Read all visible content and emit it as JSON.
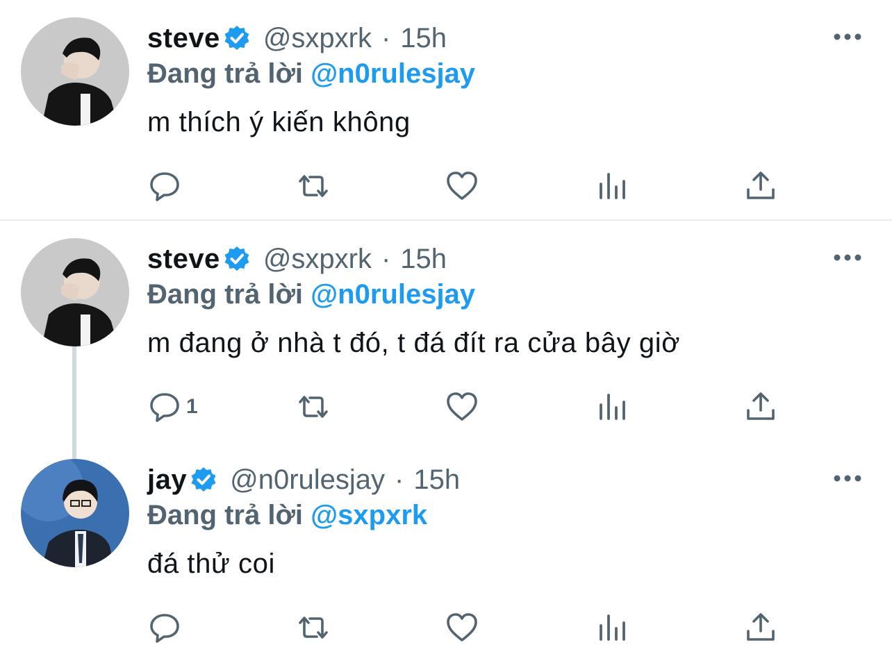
{
  "tweets": [
    {
      "name": "steve",
      "handle": "@sxpxrk",
      "separator": "·",
      "time": "15h",
      "replying_label": "Đang trả lời",
      "replying_to": "@n0rulesjay",
      "text": "m thích ý kiến không",
      "reply_count": ""
    },
    {
      "name": "steve",
      "handle": "@sxpxrk",
      "separator": "·",
      "time": "15h",
      "replying_label": "Đang trả lời",
      "replying_to": "@n0rulesjay",
      "text": "m đang ở nhà t đó, t đá đít ra cửa bây giờ",
      "reply_count": "1"
    },
    {
      "name": "jay",
      "handle": "@n0rulesjay",
      "separator": "·",
      "time": "15h",
      "replying_label": "Đang trả lời",
      "replying_to": "@sxpxrk",
      "text": "đá thử coi",
      "reply_count": ""
    }
  ],
  "icons": {
    "verified": "verified-badge-icon",
    "more": "more-options-icon",
    "reply": "reply-icon",
    "retweet": "retweet-icon",
    "like": "heart-icon",
    "views": "analytics-icon",
    "share": "share-icon"
  },
  "colors": {
    "accent": "#1d9bf0",
    "secondary_text": "#536471",
    "primary_text": "#0f1419",
    "divider": "#e6ecf0"
  }
}
